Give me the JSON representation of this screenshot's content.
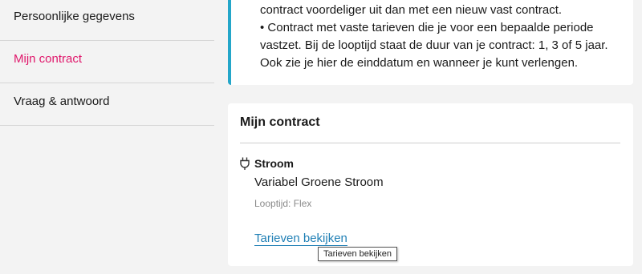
{
  "sidebar": {
    "items": [
      {
        "label": "Persoonlijke gegevens"
      },
      {
        "label": "Mijn contract"
      },
      {
        "label": "Vraag & antwoord"
      }
    ]
  },
  "info": {
    "lines": [
      "contract voordeliger uit dan met een nieuw vast contract.",
      "• Contract met vaste tarieven die je voor een bepaalde periode",
      "vastzet. Bij de looptijd staat de duur van je contract: 1, 3 of 5 jaar.",
      "Ook zie je hier de einddatum en wanneer je kunt verlengen."
    ]
  },
  "contract": {
    "title": "Mijn contract",
    "energy_type": "Stroom",
    "energy_icon": "plug-icon",
    "product": "Variabel Groene Stroom",
    "looptijd": "Looptijd: Flex",
    "link_label": "Tarieven bekijken",
    "tooltip": "Tarieven bekijken"
  },
  "colors": {
    "accent": "#e0176b",
    "info_border": "#24a6c9",
    "link": "#1f7fb5"
  }
}
